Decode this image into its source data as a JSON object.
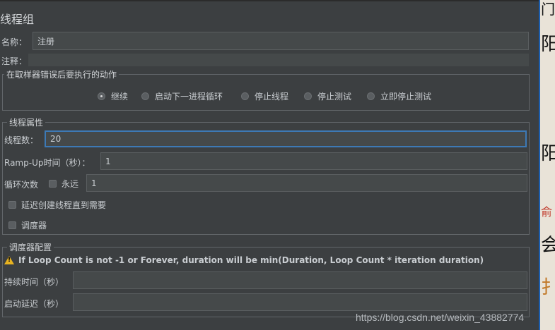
{
  "title": "线程组",
  "name": {
    "label": "名称：",
    "value": "注册"
  },
  "comment": {
    "label": "注释：",
    "value": ""
  },
  "error_action": {
    "legend": "在取样器错误后要执行的动作",
    "options": [
      {
        "label": "继续",
        "checked": true
      },
      {
        "label": "启动下一进程循环",
        "checked": false
      },
      {
        "label": "停止线程",
        "checked": false
      },
      {
        "label": "停止测试",
        "checked": false
      },
      {
        "label": "立即停止测试",
        "checked": false
      }
    ]
  },
  "thread_props": {
    "legend": "线程属性",
    "threads_label": "线程数：",
    "threads_value": "20",
    "rampup_label": "Ramp-Up时间（秒）：",
    "rampup_value": "1",
    "loop_label": "循环次数",
    "forever_label": "永远",
    "loop_value": "1",
    "delay_label": "延迟创建线程直到需要",
    "scheduler_label": "调度器"
  },
  "scheduler_config": {
    "legend": "调度器配置",
    "warning": "If Loop Count is not -1 or Forever, duration will be min(Duration, Loop Count * iteration duration)",
    "duration_label": "持续时间（秒）",
    "duration_value": "",
    "startup_delay_label": "启动延迟（秒）",
    "startup_delay_value": ""
  },
  "watermark": "https://blog.csdn.net/weixin_43882774",
  "right_strip_glyphs": [
    "阳",
    "门",
    "阳",
    "俞",
    "会",
    "扌"
  ],
  "icons": {
    "warning": "warning-triangle-icon"
  },
  "colors": {
    "background": "#3c3f41",
    "focus_border": "#3d79b5",
    "warning": "#e8b321"
  }
}
